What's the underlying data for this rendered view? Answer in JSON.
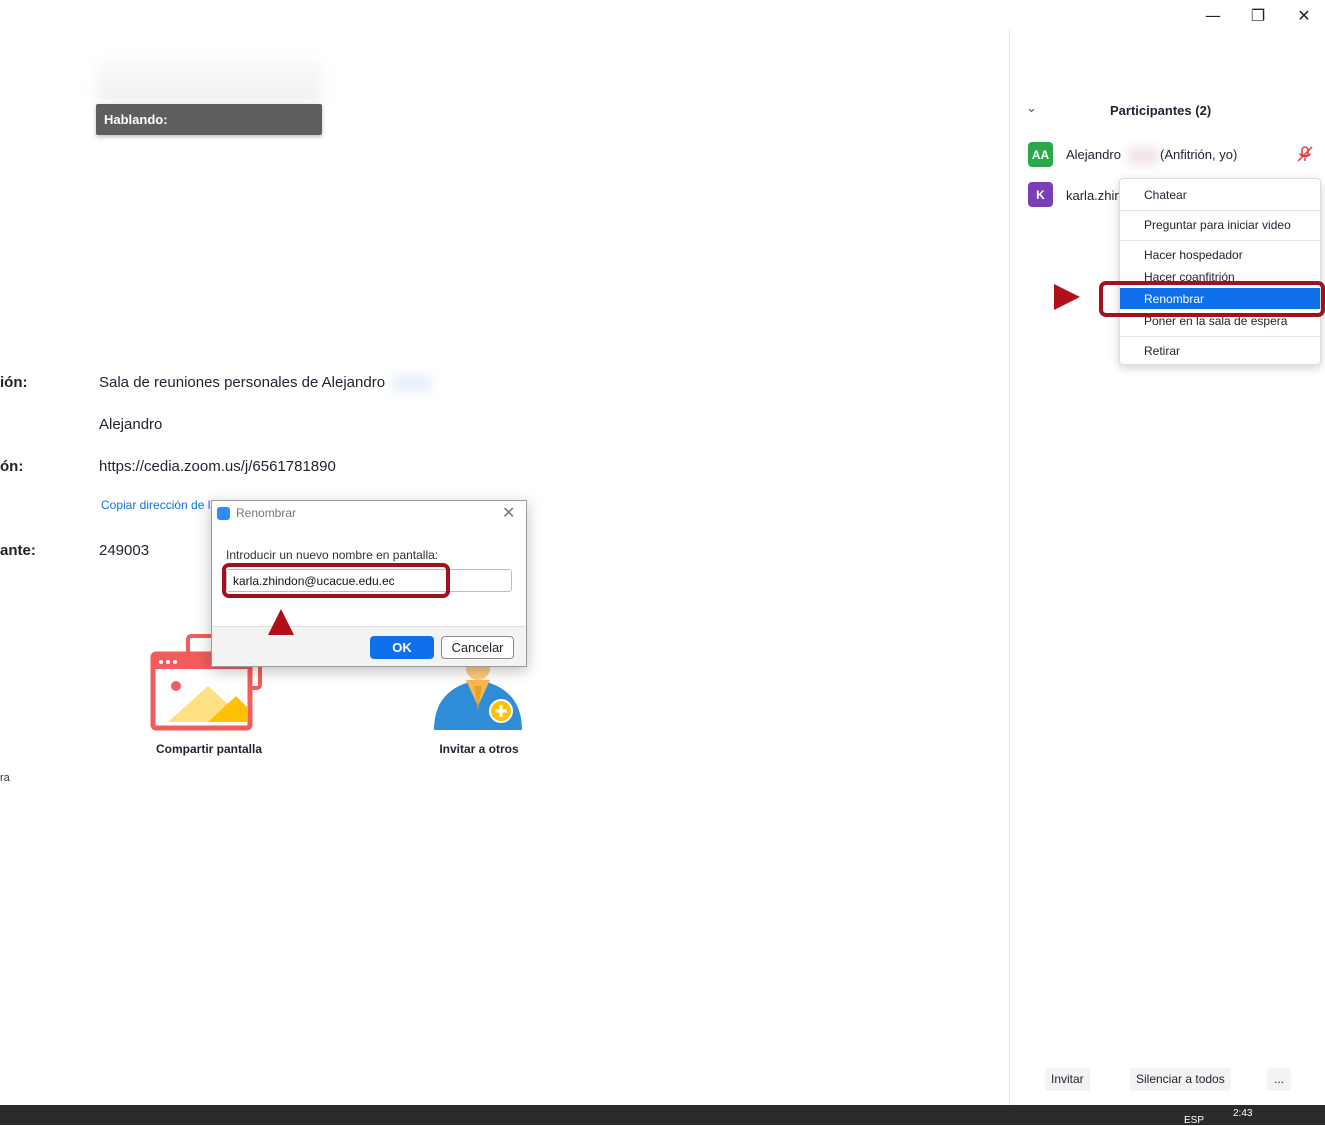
{
  "window": {
    "minimize_glyph": "—",
    "restore_glyph": "❐",
    "close_glyph": "✕"
  },
  "stage": {
    "speaking_label": "Hablando:"
  },
  "meeting_info": {
    "rows": [
      {
        "label": "ión:",
        "value": "Sala de reuniones personales de Alejandro"
      },
      {
        "label": "",
        "value": "Alejandro"
      },
      {
        "label": "ón:",
        "value": "https://cedia.zoom.us/j/6561781890"
      },
      {
        "label": "ante:",
        "value": "249003"
      }
    ],
    "copy_link": "Copiar dirección de l",
    "bottom_fragment": "ra"
  },
  "actions": {
    "share_screen": "Compartir pantalla",
    "invite_others": "Invitar a otros"
  },
  "participants": {
    "title": "Participantes (2)",
    "list": [
      {
        "initials": "AA",
        "name": "Alejandro",
        "role": "(Anfitrión, yo)",
        "color": "#2aa84a"
      },
      {
        "initials": "K",
        "name": "karla.zhin",
        "color": "#7b3fb5"
      }
    ],
    "buttons": {
      "invite": "Invitar",
      "mute_all": "Silenciar a todos",
      "more": "..."
    }
  },
  "context_menu": {
    "items": [
      "Chatear",
      "Preguntar para iniciar video",
      "Hacer hospedador",
      "Hacer coanfitrión",
      "Renombrar",
      "Poner en la sala de espera",
      "Retirar"
    ],
    "active": "Renombrar"
  },
  "rename_dialog": {
    "title": "Renombrar",
    "prompt": "Introducir un nuevo nombre en pantalla:",
    "input_value": "karla.zhindon@ucacue.edu.ec",
    "ok_label": "OK",
    "cancel_label": "Cancelar"
  },
  "taskbar": {
    "lang": "ESP",
    "time": "2:43"
  },
  "colors": {
    "accent": "#0e71eb",
    "highlight_red": "#a1121e"
  }
}
